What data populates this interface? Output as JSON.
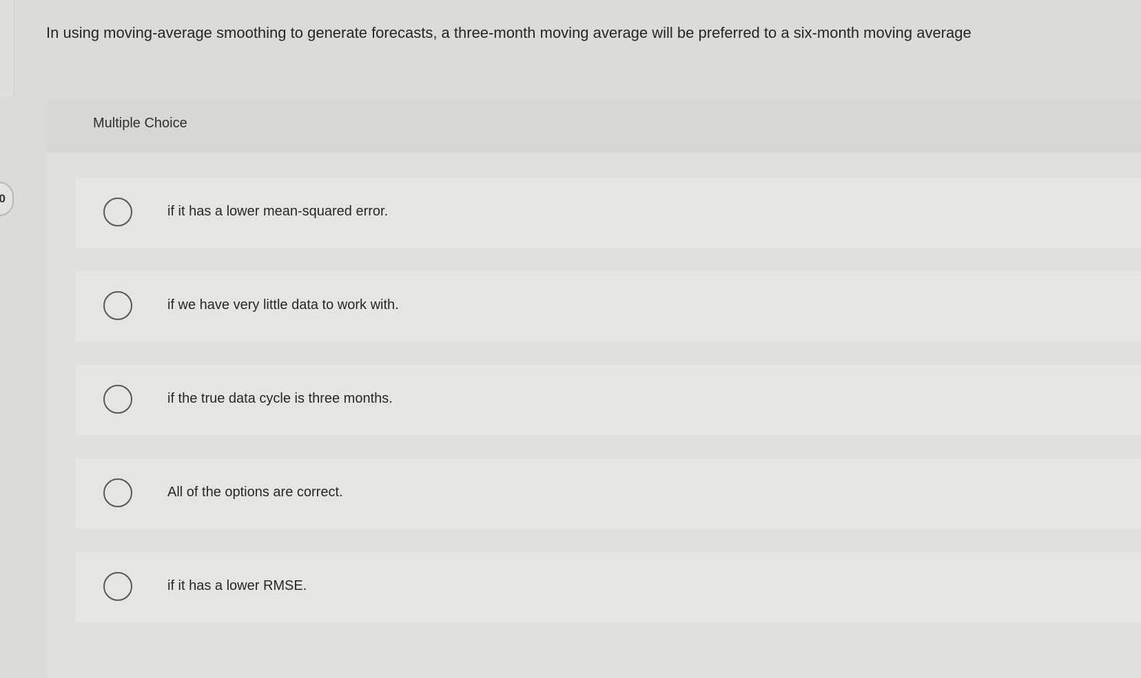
{
  "question": {
    "number": "0",
    "prompt": "In using moving-average smoothing to generate forecasts, a three-month moving average will be preferred to a six-month moving average"
  },
  "choice": {
    "type_label": "Multiple Choice",
    "options": [
      {
        "label": "if it has a lower mean-squared error."
      },
      {
        "label": "if we have very little data to work with."
      },
      {
        "label": "if the true data cycle is three months."
      },
      {
        "label": "All of the options are correct."
      },
      {
        "label": "if it has a lower RMSE."
      }
    ]
  }
}
